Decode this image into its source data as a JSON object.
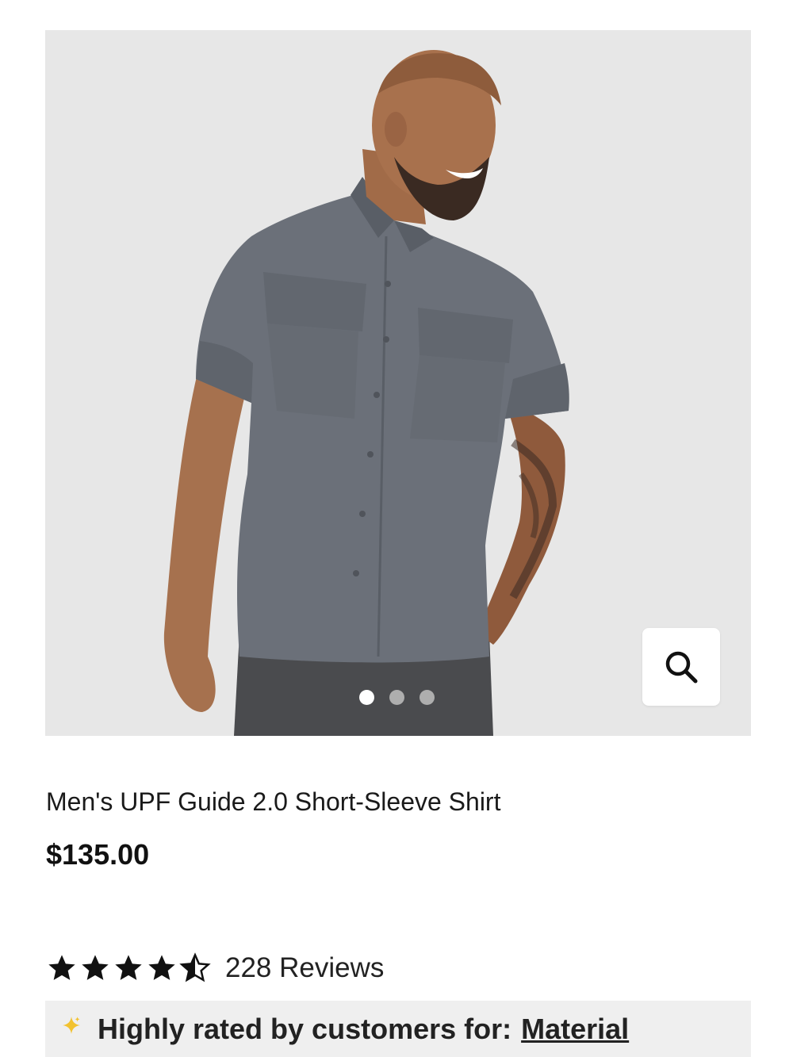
{
  "product": {
    "title": "Men's UPF Guide 2.0 Short-Sleeve Shirt",
    "price": "$135.00",
    "image": {
      "background": "#e7e7e7",
      "shirt_color": "#6b7079",
      "dots": [
        "active",
        "inactive",
        "inactive"
      ]
    }
  },
  "rating": {
    "stars": 4.5,
    "reviews_label": "228 Reviews"
  },
  "highlight": {
    "icon": "sparkle-icon",
    "text": "Highly rated by customers for:",
    "link": "Material",
    "accent": "#f2c230"
  },
  "icons": {
    "zoom": "search-icon"
  }
}
